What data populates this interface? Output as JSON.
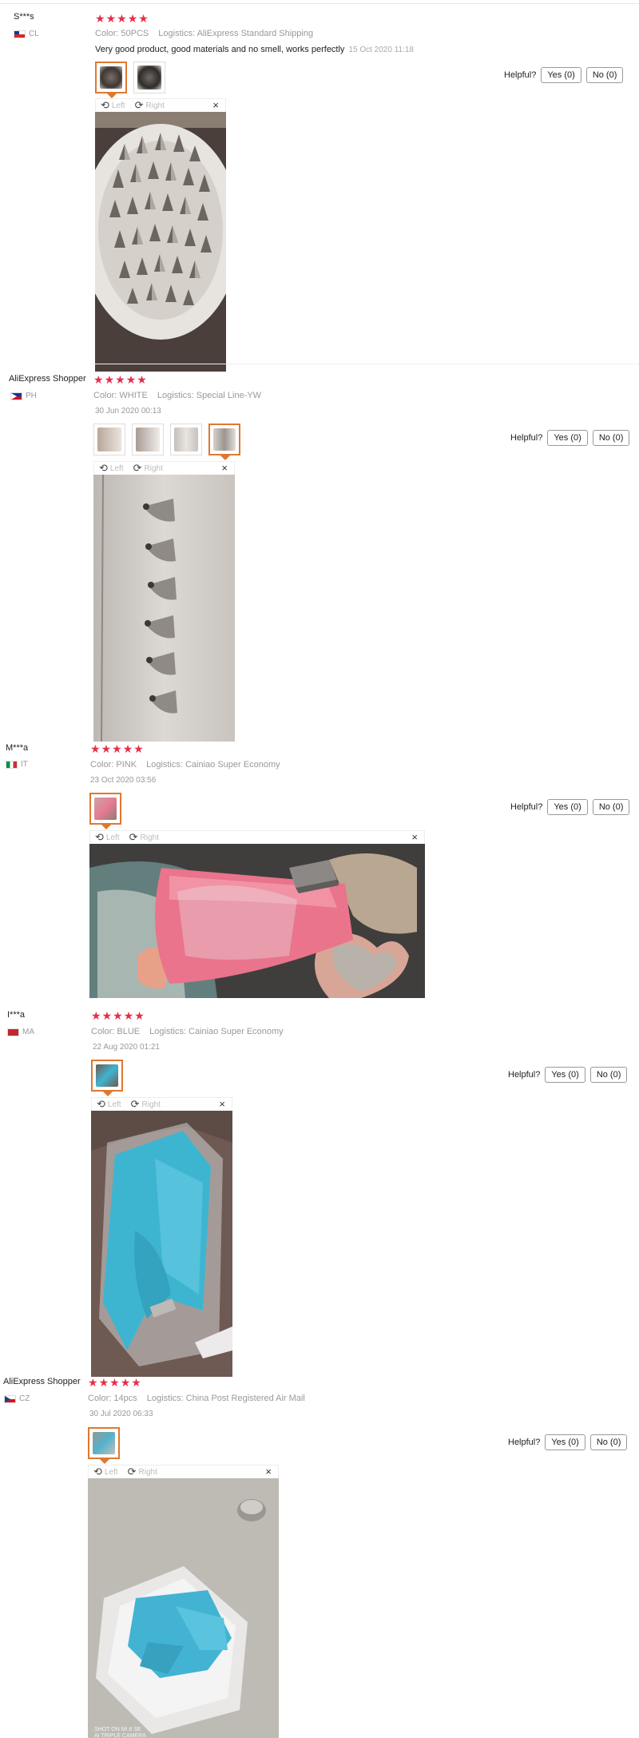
{
  "reviews": [
    {
      "user": "S***s",
      "country": "CL",
      "rating": 5,
      "color": "Color: 50PCS",
      "logistics": "Logistics: AliExpress Standard Shipping",
      "content": "Very good product, good materials and no smell, works perfectly",
      "date": "15 Oct 2020 11:18",
      "helpful_label": "Helpful?",
      "yes": "Yes (0)",
      "no": "No (0)"
    },
    {
      "user": "AliExpress Shopper",
      "country": "PH",
      "rating": 5,
      "color": "Color: WHITE",
      "logistics": "Logistics: Special Line-YW",
      "date": "30 Jun 2020 00:13",
      "helpful_label": "Helpful?",
      "yes": "Yes (0)",
      "no": "No (0)"
    },
    {
      "user": "M***a",
      "country": "IT",
      "rating": 5,
      "color": "Color: PINK",
      "logistics": "Logistics: Cainiao Super Economy",
      "date": "23 Oct 2020 03:56",
      "helpful_label": "Helpful?",
      "yes": "Yes (0)",
      "no": "No (0)"
    },
    {
      "user": "I***a",
      "country": "MA",
      "rating": 5,
      "color": "Color: BLUE",
      "logistics": "Logistics: Cainiao Super Economy",
      "date": "22 Aug 2020 01:21",
      "helpful_label": "Helpful?",
      "yes": "Yes (0)",
      "no": "No (0)"
    },
    {
      "user": "AliExpress Shopper",
      "country": "CZ",
      "rating": 5,
      "color": "Color: 14pcs",
      "logistics": "Logistics: China Post Registered Air Mail",
      "date": "30 Jul 2020 06:33",
      "helpful_label": "Helpful?",
      "yes": "Yes (0)",
      "no": "No (0)"
    }
  ],
  "viewer": {
    "left_label": "Left",
    "right_label": "Right",
    "close_symbol": "×",
    "rotate_left_icon": "rotate-left-icon",
    "rotate_right_icon": "rotate-right-icon"
  },
  "photo_watermark": "SHOT ON MI 8 SE\nAI TRIPLE CAMERA",
  "colors": {
    "star": "#e62e4a",
    "active_thumb_border": "#e0782f"
  }
}
